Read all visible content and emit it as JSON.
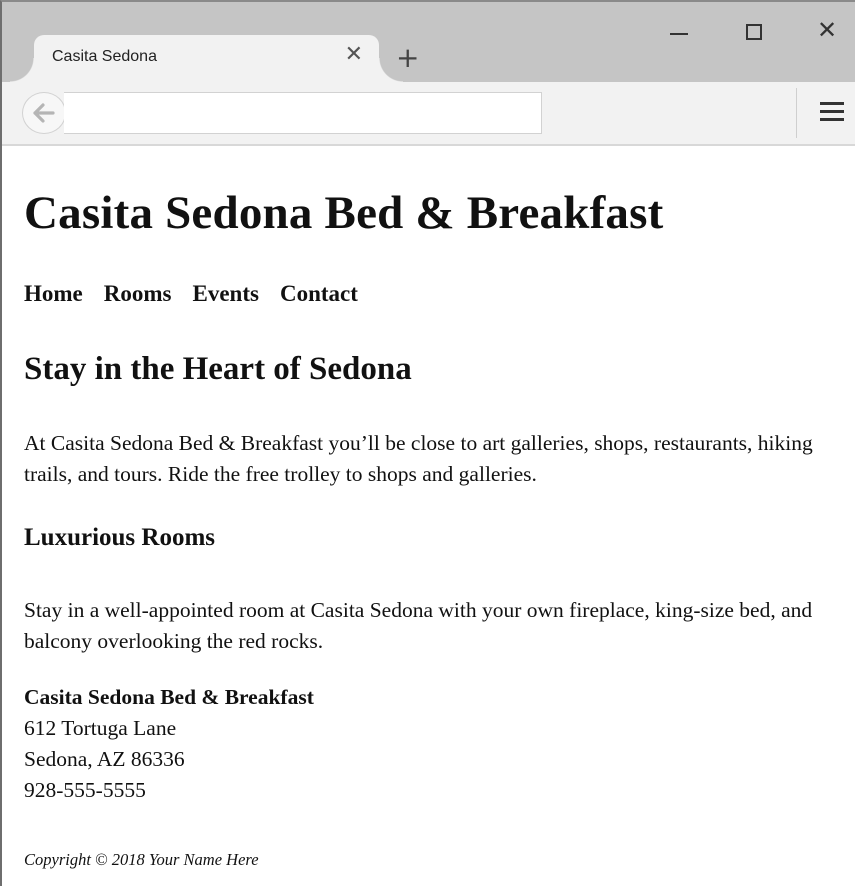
{
  "browser": {
    "tab_title": "Casita Sedona",
    "tab_close_icon": "close-icon",
    "new_tab_label": "+",
    "window_controls": {
      "minimize_icon": "minimize-icon",
      "maximize_icon": "maximize-icon",
      "close_symbol": "✕"
    },
    "back_icon": "arrow-left-icon",
    "url_value": "",
    "menu_icon": "hamburger-menu-icon"
  },
  "page": {
    "site_title": "Casita Sedona Bed & Breakfast",
    "nav": [
      {
        "label": "Home"
      },
      {
        "label": "Rooms"
      },
      {
        "label": "Events"
      },
      {
        "label": "Contact"
      }
    ],
    "hero_heading": "Stay in the Heart of Sedona",
    "intro": "At Casita Sedona Bed & Breakfast you’ll be close to art galleries, shops, restaurants, hiking trails, and tours. Ride the free trolley to shops and galleries.",
    "rooms_heading": "Luxurious Rooms",
    "rooms_text": "Stay in a well-appointed room at Casita Sedona with your own fireplace, king-size bed, and balcony overlooking the red rocks.",
    "address": {
      "name": "Casita Sedona Bed & Breakfast",
      "street": "612 Tortuga Lane",
      "city": "Sedona, AZ 86336",
      "phone": "928-555-5555"
    },
    "footer": "Copyright © 2018 Your Name Here"
  }
}
